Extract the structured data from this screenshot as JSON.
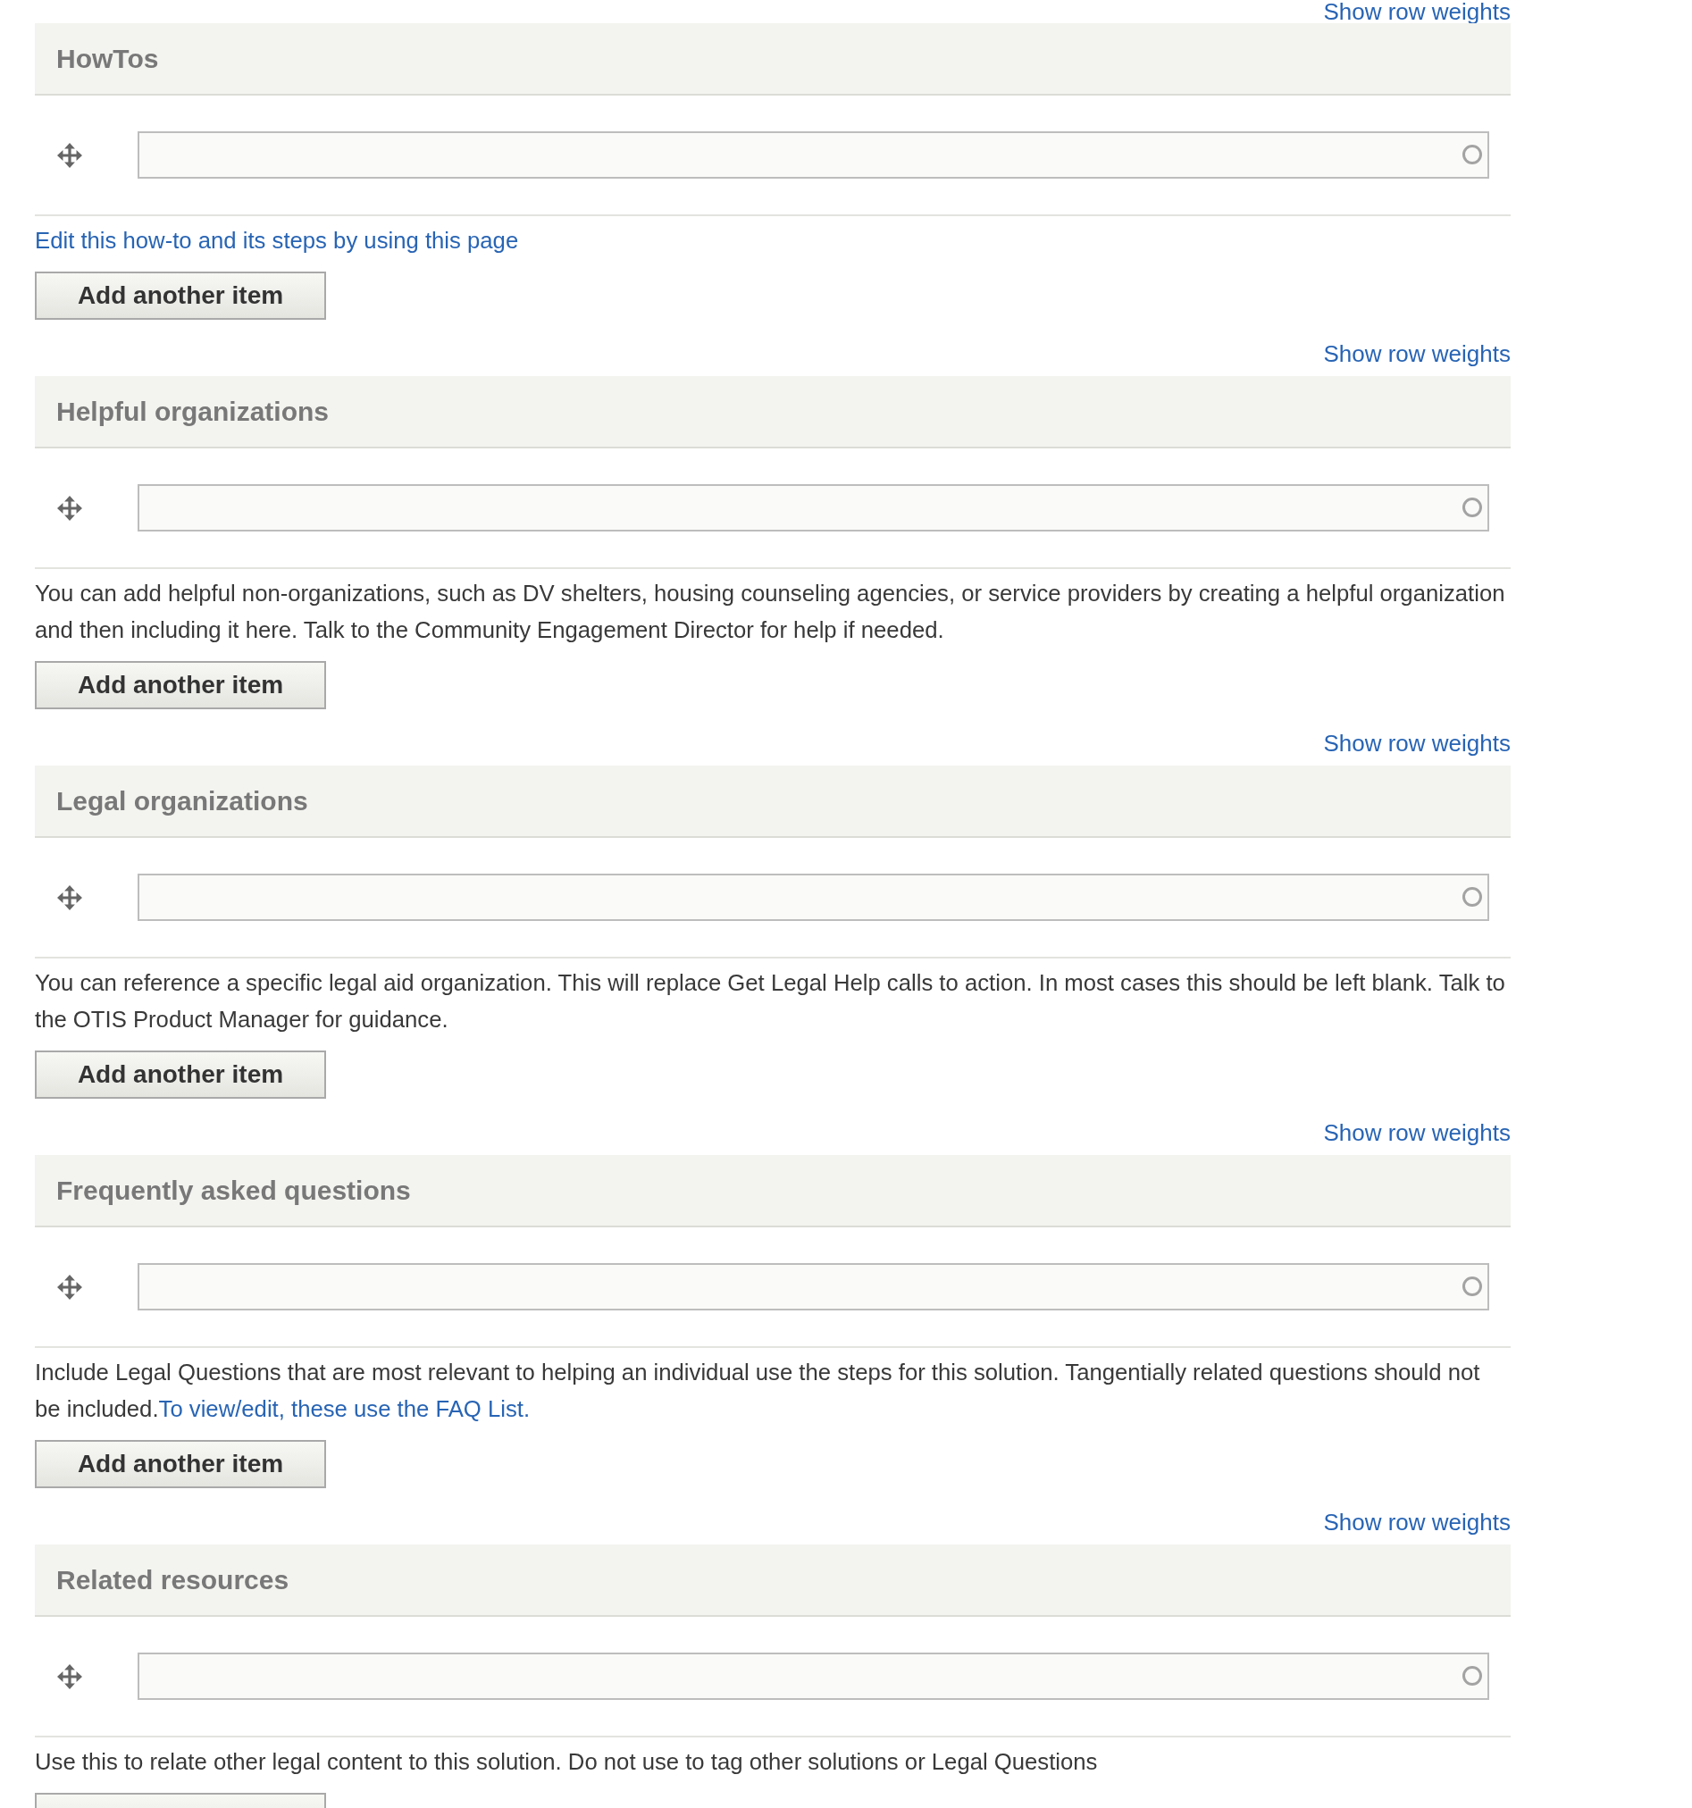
{
  "sections": [
    {
      "weights_link": "Show row weights",
      "title": "HowTos",
      "description": [
        {
          "kind": "link",
          "text": "Edit this how-to and its steps by using this page"
        }
      ],
      "button": "Add another item"
    },
    {
      "weights_link": "Show row weights",
      "title": "Helpful organizations",
      "description": [
        {
          "kind": "text",
          "text": "You can add helpful non-organizations, such as DV shelters, housing counseling agencies, or service providers by creating a helpful organization and then including it here. Talk to the Community Engagement Director for help if needed."
        }
      ],
      "button": "Add another item"
    },
    {
      "weights_link": "Show row weights",
      "title": "Legal organizations",
      "description": [
        {
          "kind": "text",
          "text": "You can reference a specific legal aid organization. This will replace Get Legal Help calls to action. In most cases this should be left blank. Talk to the OTIS Product Manager for guidance."
        }
      ],
      "button": "Add another item"
    },
    {
      "weights_link": "Show row weights",
      "title": "Frequently asked questions",
      "description": [
        {
          "kind": "text",
          "text": "Include Legal Questions that are most relevant to helping an individual use the steps for this solution. Tangentially related questions should not be included."
        },
        {
          "kind": "link",
          "text": "To view/edit, these use the FAQ List."
        }
      ],
      "button": "Add another item"
    },
    {
      "weights_link": "Show row weights",
      "title": "Related resources",
      "description": [
        {
          "kind": "text",
          "text": "Use this to relate other legal content to this solution. Do not use to tag other solutions or Legal Questions"
        }
      ]
    }
  ]
}
